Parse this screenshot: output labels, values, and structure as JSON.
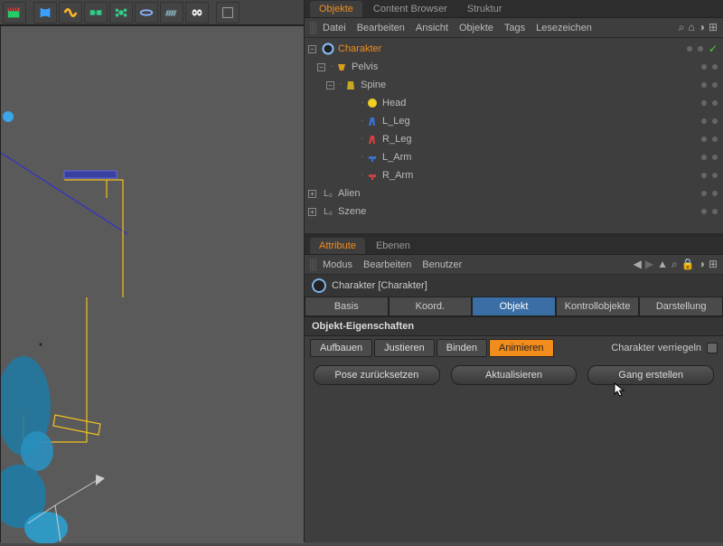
{
  "topTabs": {
    "objekte": "Objekte",
    "content": "Content Browser",
    "struktur": "Struktur"
  },
  "menubar": {
    "datei": "Datei",
    "bearbeiten": "Bearbeiten",
    "ansicht": "Ansicht",
    "objekte": "Objekte",
    "tags": "Tags",
    "lesezeichen": "Lesezeichen"
  },
  "tree": {
    "charakter": "Charakter",
    "pelvis": "Pelvis",
    "spine": "Spine",
    "head": "Head",
    "l_leg": "L_Leg",
    "r_leg": "R_Leg",
    "l_arm": "L_Arm",
    "r_arm": "R_Arm",
    "alien": "Alien",
    "szene": "Szene"
  },
  "attrTabs": {
    "attribute": "Attribute",
    "ebenen": "Ebenen"
  },
  "attrMenu": {
    "modus": "Modus",
    "bearbeiten": "Bearbeiten",
    "benutzer": "Benutzer"
  },
  "objHead": "Charakter [Charakter]",
  "modeTabs": {
    "basis": "Basis",
    "koord": "Koord.",
    "objekt": "Objekt",
    "kontroll": "Kontrollobjekte",
    "darstellung": "Darstellung"
  },
  "sectionLabel": "Objekt-Eigenschaften",
  "subTabs": {
    "aufbauen": "Aufbauen",
    "justieren": "Justieren",
    "binden": "Binden",
    "animieren": "Animieren"
  },
  "lockLabel": "Charakter verriegeln",
  "buttons": {
    "pose": "Pose zurücksetzen",
    "aktual": "Aktualisieren",
    "gang": "Gang erstellen"
  },
  "colors": {
    "orange": "#f28c1c",
    "blue": "#3a6ea5"
  }
}
